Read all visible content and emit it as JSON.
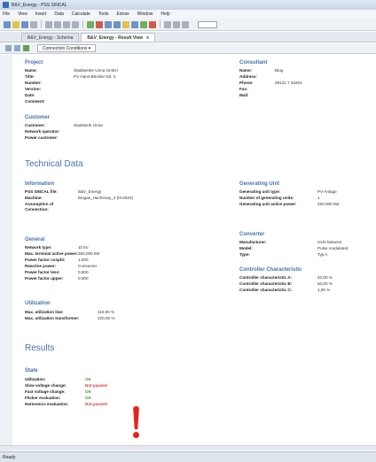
{
  "window": {
    "title": "B&V_Energy - PSS SINCAL"
  },
  "menu": [
    "File",
    "View",
    "Insert",
    "Data",
    "Calculate",
    "Tools",
    "Extras",
    "Window",
    "Help"
  ],
  "tabs": [
    {
      "label": "B&V_Energy - Schema"
    },
    {
      "label": "B&V_Energy - Result View",
      "close": "x"
    }
  ],
  "subtoolbar": {
    "connection_label": "Connection Conditions ▾"
  },
  "project": {
    "title": "Project",
    "rows": [
      {
        "label": "Name:",
        "value": "Stadtwerke Unna GmbH"
      },
      {
        "label": "Title:",
        "value": "PV Hans-Böckler-Str. 3"
      },
      {
        "label": "Number:",
        "value": ""
      },
      {
        "label": "Version:",
        "value": ""
      },
      {
        "label": "Date:",
        "value": ""
      },
      {
        "label": "Comment:",
        "value": ""
      }
    ]
  },
  "consultant": {
    "title": "Consultant",
    "rows": [
      {
        "label": "Name:",
        "value": "Blug"
      },
      {
        "label": "Address:",
        "value": ""
      },
      {
        "label": "Phone:",
        "value": "09131 7 33204"
      },
      {
        "label": "Fax:",
        "value": ""
      },
      {
        "label": "Mail:",
        "value": ""
      }
    ]
  },
  "customer": {
    "title": "Customer",
    "rows": [
      {
        "label": "Customer:",
        "value": "Stadtwerk Unna"
      },
      {
        "label": "Network operator:",
        "value": ""
      },
      {
        "label": "Power customer:",
        "value": ""
      }
    ]
  },
  "technical_title": "Technical Data",
  "information": {
    "title": "Information",
    "rows": [
      {
        "label": "PSS SINCAL file:",
        "value": "B&V_Energy"
      },
      {
        "label": "Machine:",
        "value": "Biogas_Hachenay_2 (bl-2632)"
      },
      {
        "label": "Assumption of",
        "value": ""
      },
      {
        "label": "Connection:",
        "value": ""
      }
    ]
  },
  "generating_unit": {
    "title": "Generating Unit",
    "rows": [
      {
        "label": "Generating unit type:",
        "value": "PV-Anlage"
      },
      {
        "label": "Number of generating units:",
        "value": "1"
      },
      {
        "label": "Generating unit active power:",
        "value": "250,000 kW"
      }
    ]
  },
  "general": {
    "title": "General",
    "rows": [
      {
        "label": "Network type:",
        "value": "10 kV"
      },
      {
        "label": "Max. terminal active power:",
        "value": "250,000 kW"
      },
      {
        "label": "Power factor cosphi:",
        "value": "1,000"
      },
      {
        "label": "Reactive power:",
        "value": "Consumer"
      },
      {
        "label": "Power factor less:",
        "value": "0,900"
      },
      {
        "label": "Power factor upper:",
        "value": "0,900"
      }
    ]
  },
  "converter": {
    "title": "Converter",
    "rows": [
      {
        "label": "Manufacturer:",
        "value": "nicht bekannt"
      },
      {
        "label": "Model:",
        "value": "Pulse modulated"
      },
      {
        "label": "Type:",
        "value": "Typ A"
      }
    ]
  },
  "controller": {
    "title": "Controller Characteristic",
    "rows": [
      {
        "label": "Controller characteristic A:",
        "value": "20,00 %"
      },
      {
        "label": "Controller characteristic B:",
        "value": "50,00 %"
      },
      {
        "label": "Controller characteristic C:",
        "value": "1,00 %"
      }
    ]
  },
  "utilization": {
    "title": "Utilization",
    "rows": [
      {
        "label": "Max. utilization line:",
        "value": "110,00 %"
      },
      {
        "label": "Max. utilization transformer:",
        "value": "100,00 %"
      }
    ]
  },
  "results_title": "Results",
  "state": {
    "title": "State",
    "rows": [
      {
        "label": "Utilization:",
        "value": "OK",
        "status": "ok"
      },
      {
        "label": "Slow voltage change:",
        "value": "Not passed",
        "status": "bad"
      },
      {
        "label": "Fast voltage change:",
        "value": "OK",
        "status": "ok"
      },
      {
        "label": "Flicker evaluation:",
        "value": "OK",
        "status": "ok"
      },
      {
        "label": "Harmonics evaluation:",
        "value": "Not passed",
        "status": "bad"
      }
    ]
  },
  "statusbar": {
    "text": "Ready"
  },
  "colors": {
    "accent": "#4472a8",
    "ok": "#2e9a37",
    "bad": "#d23a2e",
    "alert": "#e5231b"
  }
}
